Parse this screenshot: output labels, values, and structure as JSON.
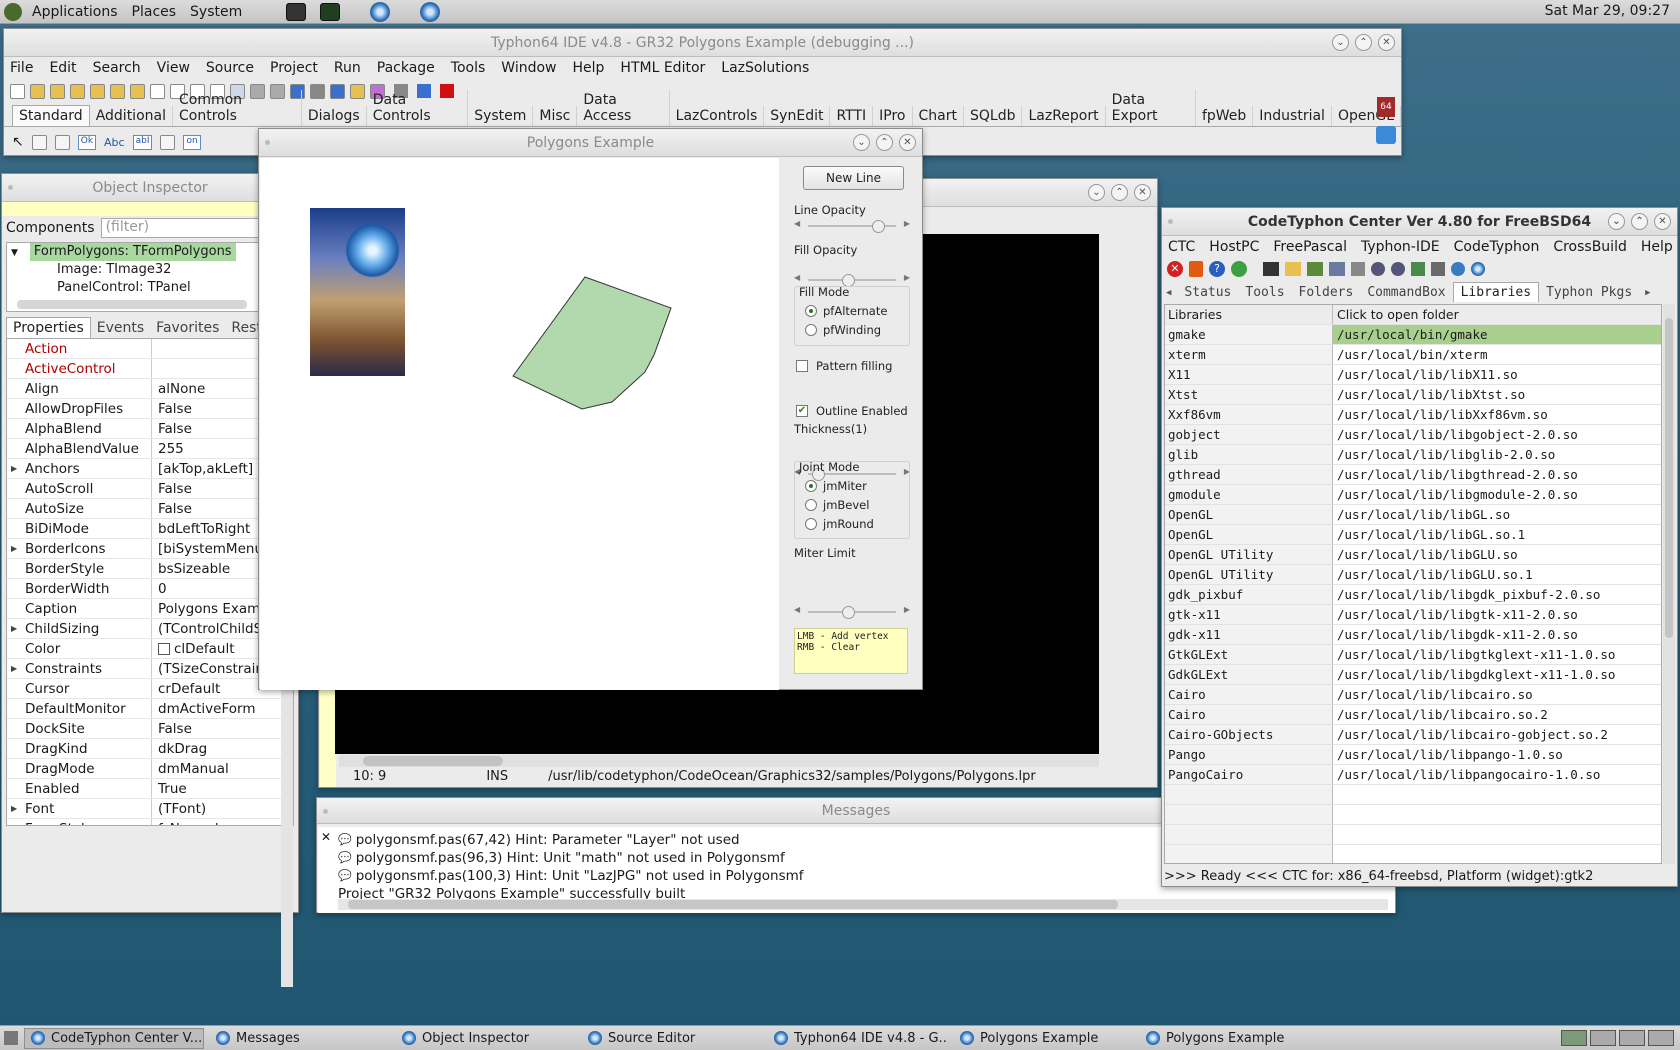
{
  "top_panel": {
    "menus": [
      "Applications",
      "Places",
      "System"
    ],
    "clock": "Sat Mar 29, 09:27"
  },
  "ide": {
    "title": "Typhon64 IDE v4.8 - GR32 Polygons Example (debugging ...)",
    "menu": [
      "File",
      "Edit",
      "Search",
      "View",
      "Source",
      "Project",
      "Run",
      "Package",
      "Tools",
      "Window",
      "Help",
      "HTML Editor",
      "LazSolutions"
    ],
    "palette_tabs": [
      "Standard",
      "Additional",
      "Common Controls",
      "Dialogs",
      "Data Controls",
      "System",
      "Misc",
      "Data Access",
      "LazControls",
      "SynEdit",
      "RTTI",
      "IPro",
      "Chart",
      "SQLdb",
      "LazReport",
      "Data Export",
      "fpWeb",
      "Industrial",
      "OpenGL"
    ],
    "palette_icons": [
      "Ok",
      "Abc",
      "abI",
      "on"
    ],
    "badge": "64"
  },
  "object_inspector": {
    "title": "Object Inspector",
    "components_label": "Components",
    "filter_placeholder": "(filter)",
    "tree": [
      "FormPolygons: TFormPolygons",
      "Image: TImage32",
      "PanelControl: TPanel"
    ],
    "tabs": [
      "Properties",
      "Events",
      "Favorites",
      "Restrict"
    ],
    "properties": [
      {
        "name": "Action",
        "value": "",
        "red": true
      },
      {
        "name": "ActiveControl",
        "value": "",
        "red": true
      },
      {
        "name": "Align",
        "value": "alNone"
      },
      {
        "name": "AllowDropFiles",
        "value": "False"
      },
      {
        "name": "AlphaBlend",
        "value": "False"
      },
      {
        "name": "AlphaBlendValue",
        "value": "255"
      },
      {
        "name": "Anchors",
        "value": "[akTop,akLeft]",
        "expand": true
      },
      {
        "name": "AutoScroll",
        "value": "False"
      },
      {
        "name": "AutoSize",
        "value": "False"
      },
      {
        "name": "BiDiMode",
        "value": "bdLeftToRight"
      },
      {
        "name": "BorderIcons",
        "value": "[biSystemMenu,b",
        "expand": true
      },
      {
        "name": "BorderStyle",
        "value": "bsSizeable"
      },
      {
        "name": "BorderWidth",
        "value": "0"
      },
      {
        "name": "Caption",
        "value": "Polygons Examp"
      },
      {
        "name": "ChildSizing",
        "value": "(TControlChildSiz",
        "expand": true
      },
      {
        "name": "Color",
        "value": "clDefault",
        "swatch": true
      },
      {
        "name": "Constraints",
        "value": "(TSizeConstraint",
        "expand": true
      },
      {
        "name": "Cursor",
        "value": "crDefault"
      },
      {
        "name": "DefaultMonitor",
        "value": "dmActiveForm"
      },
      {
        "name": "DockSite",
        "value": "False"
      },
      {
        "name": "DragKind",
        "value": "dkDrag"
      },
      {
        "name": "DragMode",
        "value": "dmManual"
      },
      {
        "name": "Enabled",
        "value": "True"
      },
      {
        "name": "Font",
        "value": "(TFont)",
        "expand": true
      },
      {
        "name": "FormStyle",
        "value": "fsNormal"
      }
    ]
  },
  "polygons": {
    "title": "Polygons Example",
    "new_line": "New Line",
    "line_opacity": "Line Opacity",
    "line_opacity_value": 0.85,
    "fill_opacity": "Fill Opacity",
    "fill_opacity_value": 0.45,
    "fill_mode": "Fill Mode",
    "fill_modes": [
      {
        "label": "pfAlternate",
        "on": true
      },
      {
        "label": "pfWinding",
        "on": false
      }
    ],
    "pattern": "Pattern filling",
    "outline": "Outline Enabled",
    "thickness": "Thickness(1)",
    "thickness_value": 0.05,
    "joint_mode": "Joint Mode",
    "joint_modes": [
      {
        "label": "jmMiter",
        "on": true
      },
      {
        "label": "jmBevel",
        "on": false
      },
      {
        "label": "jmRound",
        "on": false
      }
    ],
    "miter_limit": "Miter Limit",
    "miter_value": 0.45,
    "hint1": "LMB - Add vertex",
    "hint2": "RMB - Clear",
    "fill_color": "#b2d8ad"
  },
  "source_editor": {
    "status_pos": "10:  9",
    "status_mode": "INS",
    "status_file": "/usr/lib/codetyphon/CodeOcean/Graphics32/samples/Polygons/Polygons.lpr"
  },
  "messages": {
    "title": "Messages",
    "lines": [
      "polygonsmf.pas(67,42) Hint: Parameter \"Layer\" not used",
      "polygonsmf.pas(96,3) Hint: Unit \"math\" not used in Polygonsmf",
      "polygonsmf.pas(100,3) Hint: Unit \"LazJPG\" not used in Polygonsmf",
      "Project \"GR32 Polygons Example\" successfully built"
    ]
  },
  "ctc": {
    "title": "CodeTyphon Center Ver 4.80 for FreeBSD64",
    "menu": [
      "CTC",
      "HostPC",
      "FreePascal",
      "Typhon-IDE",
      "CodeTyphon",
      "CrossBuild",
      "Help"
    ],
    "tabs": [
      "Status",
      "Tools",
      "Folders",
      "CommandBox",
      "Libraries",
      "Typhon Pkgs"
    ],
    "col1": "Libraries",
    "col2": "Click to open folder",
    "rows": [
      [
        "gmake",
        "/usr/local/bin/gmake"
      ],
      [
        "xterm",
        "/usr/local/bin/xterm"
      ],
      [
        "X11",
        "/usr/local/lib/libX11.so"
      ],
      [
        "Xtst",
        "/usr/local/lib/libXtst.so"
      ],
      [
        "Xxf86vm",
        "/usr/local/lib/libXxf86vm.so"
      ],
      [
        "gobject",
        "/usr/local/lib/libgobject-2.0.so"
      ],
      [
        "glib",
        "/usr/local/lib/libglib-2.0.so"
      ],
      [
        "gthread",
        "/usr/local/lib/libgthread-2.0.so"
      ],
      [
        "gmodule",
        "/usr/local/lib/libgmodule-2.0.so"
      ],
      [
        "OpenGL",
        "/usr/local/lib/libGL.so"
      ],
      [
        "OpenGL",
        "/usr/local/lib/libGL.so.1"
      ],
      [
        "OpenGL UTility",
        "/usr/local/lib/libGLU.so"
      ],
      [
        "OpenGL UTility",
        "/usr/local/lib/libGLU.so.1"
      ],
      [
        "gdk_pixbuf",
        "/usr/local/lib/libgdk_pixbuf-2.0.so"
      ],
      [
        "gtk-x11",
        "/usr/local/lib/libgtk-x11-2.0.so"
      ],
      [
        "gdk-x11",
        "/usr/local/lib/libgdk-x11-2.0.so"
      ],
      [
        "GtkGLExt",
        "/usr/local/lib/libgtkglext-x11-1.0.so"
      ],
      [
        "GdkGLExt",
        "/usr/local/lib/libgdkglext-x11-1.0.so"
      ],
      [
        "Cairo",
        "/usr/local/lib/libcairo.so"
      ],
      [
        "Cairo",
        "/usr/local/lib/libcairo.so.2"
      ],
      [
        "Cairo-GObjects",
        "/usr/local/lib/libcairo-gobject.so.2"
      ],
      [
        "Pango",
        "/usr/local/lib/libpango-1.0.so"
      ],
      [
        "PangoCairo",
        "/usr/local/lib/libpangocairo-1.0.so"
      ]
    ],
    "status": ">>> Ready <<<   CTC for: x86_64-freebsd, Platform (widget):gtk2"
  },
  "taskbar": [
    "CodeTyphon Center V...",
    "Messages",
    "Object Inspector",
    "Source Editor",
    "Typhon64 IDE v4.8 - G...",
    "Polygons Example",
    "Polygons Example"
  ]
}
